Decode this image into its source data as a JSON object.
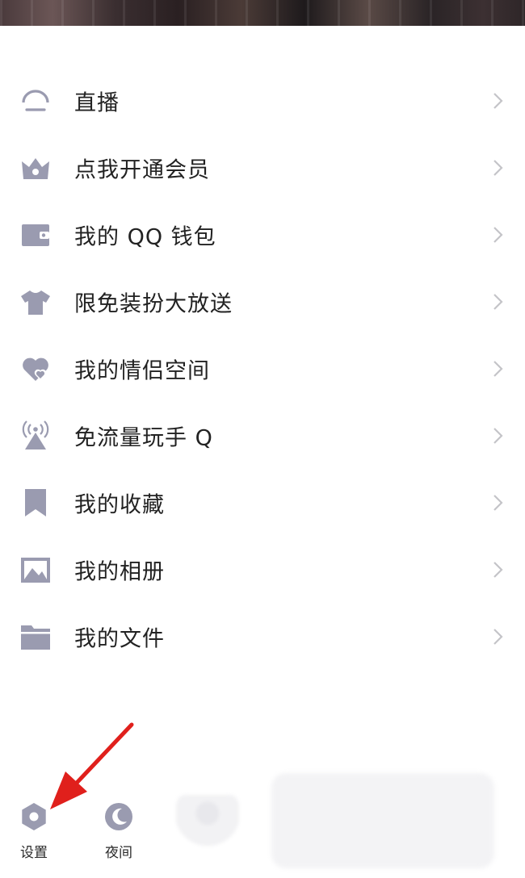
{
  "menu": {
    "items": [
      {
        "label": "直播",
        "icon": "live-icon"
      },
      {
        "label": "点我开通会员",
        "icon": "crown-icon"
      },
      {
        "label": "我的 QQ 钱包",
        "icon": "wallet-icon"
      },
      {
        "label": "限免装扮大放送",
        "icon": "shirt-icon"
      },
      {
        "label": "我的情侣空间",
        "icon": "couple-heart-icon"
      },
      {
        "label": "免流量玩手 Q",
        "icon": "signal-tower-icon"
      },
      {
        "label": "我的收藏",
        "icon": "bookmark-icon"
      },
      {
        "label": "我的相册",
        "icon": "photo-album-icon"
      },
      {
        "label": "我的文件",
        "icon": "folder-icon"
      }
    ]
  },
  "bottom_bar": {
    "settings_label": "设置",
    "night_label": "夜间"
  },
  "colors": {
    "icon": "#9a9bb0",
    "chevron": "#c4c4c8",
    "annotation_arrow": "#e0201c",
    "text": "#222222"
  }
}
